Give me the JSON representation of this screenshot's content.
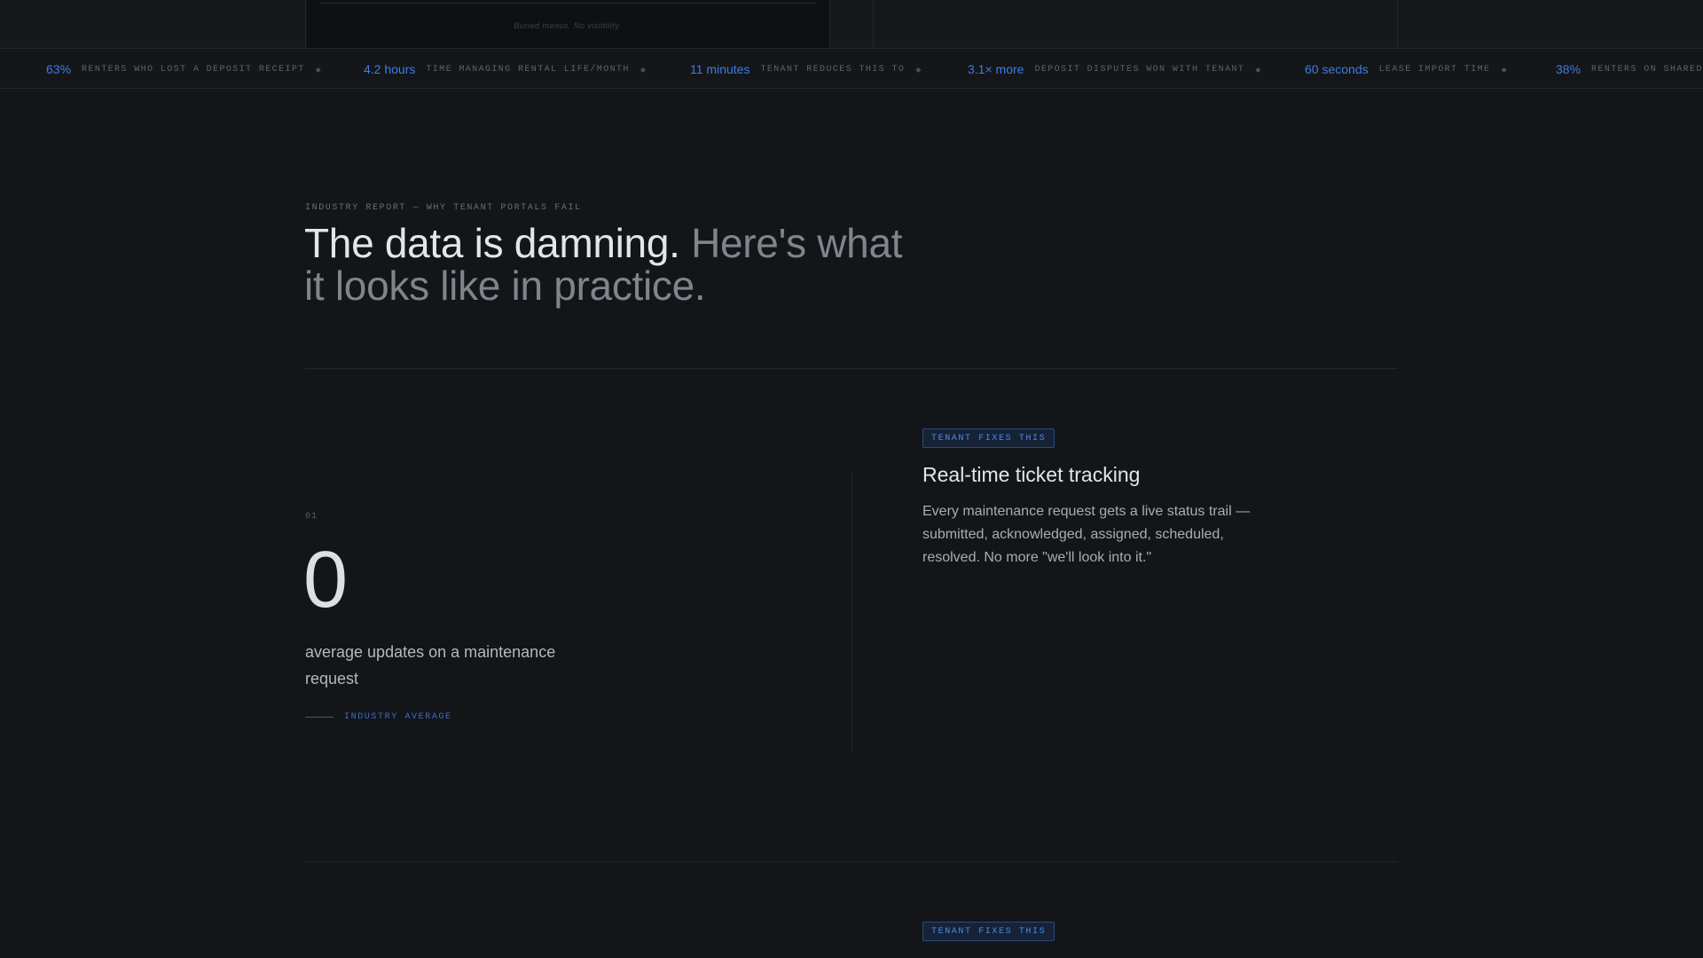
{
  "previous_section": {
    "caption": "Buried menus. No visibility."
  },
  "ticker": [
    {
      "value": "63%",
      "label": "Renters who lost a deposit receipt"
    },
    {
      "value": "4.2 hours",
      "label": "Time managing rental life/month"
    },
    {
      "value": "11 minutes",
      "label": "Tenant reduces this to"
    },
    {
      "value": "3.1× more",
      "label": "Deposit disputes won with Tenant"
    },
    {
      "value": "60 seconds",
      "label": "Lease import time"
    },
    {
      "value": "38%",
      "label": "Renters on shared"
    }
  ],
  "ticker_separator": "◆",
  "header": {
    "eyebrow": "INDUSTRY REPORT — WHY TENANT PORTALS FAIL",
    "headline_strong": "The data is damning.",
    "headline_muted": "Here's what it looks like in practice."
  },
  "stats": [
    {
      "index": "01",
      "number": "0",
      "description": "average updates on a maintenance request",
      "source": "INDUSTRY AVERAGE",
      "fix_badge": "TENANT FIXES THIS",
      "fix_title": "Real-time ticket tracking",
      "fix_description": "Every maintenance request gets a live status trail — submitted, acknowledged, assigned, scheduled, resolved. No more \"we'll look into it.\""
    },
    {
      "fix_badge": "TENANT FIXES THIS"
    }
  ],
  "colors": {
    "background": "#131519",
    "accent": "#3d7ce6",
    "badge_text": "#4f8ae8"
  }
}
